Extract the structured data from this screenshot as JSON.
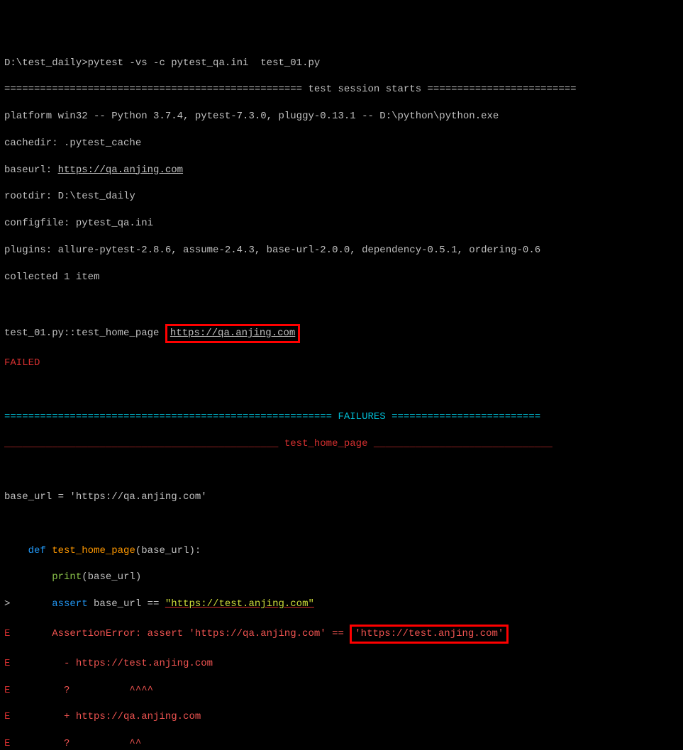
{
  "cmd": {
    "path": "D:\\test_daily>",
    "command": "pytest -vs -c pytest_qa.ini  test_01.py"
  },
  "session": {
    "divider_left": "==================================================",
    "starts": " test session starts ",
    "divider_right": "=========================",
    "platform": "platform win32 -- Python 3.7.4, pytest-7.3.0, pluggy-0.13.1 -- D:\\python\\python.exe",
    "cachedir": "cachedir: .pytest_cache",
    "baseurl_label": "baseurl: ",
    "baseurl_value": "https://qa.anjing.com",
    "rootdir": "rootdir: D:\\test_daily",
    "configfile": "configfile: pytest_qa.ini",
    "plugins": "plugins: allure-pytest-2.8.6, assume-2.4.3, base-url-2.0.0, dependency-0.5.1, ordering-0.6",
    "collected": "collected 1 item"
  },
  "testline": {
    "name": "test_01.py::test_home_page ",
    "url": "https://qa.anjing.com",
    "failed": "FAILED"
  },
  "failures": {
    "div_left": "=======================================================",
    "label": " FAILURES ",
    "div_right": "=========================",
    "sub_left": "______________________________________________",
    "sub_name": " test_home_page ",
    "sub_right": "______________________________"
  },
  "code": {
    "base_url_assign": "base_url = 'https://qa.anjing.com'",
    "indent1": "    ",
    "def": "def",
    "funcname": " test_home_page",
    "params": "(base_url):",
    "indent2": "        ",
    "print": "print",
    "print_arg": "(base_url)",
    "assert": "assert",
    "assert_expr_1": " base_url == ",
    "assert_expr_2": "\"https://test.anjing.com\"",
    "err_prefix": "AssertionError: assert 'https://qa.anjing.com' == ",
    "err_box": "'https://test.anjing.com'",
    "diff_minus": "- https://test.anjing.com",
    "diff_q1": "?          ^^^^",
    "diff_plus": "+ https://qa.anjing.com",
    "diff_q2": "?          ^^"
  }
}
